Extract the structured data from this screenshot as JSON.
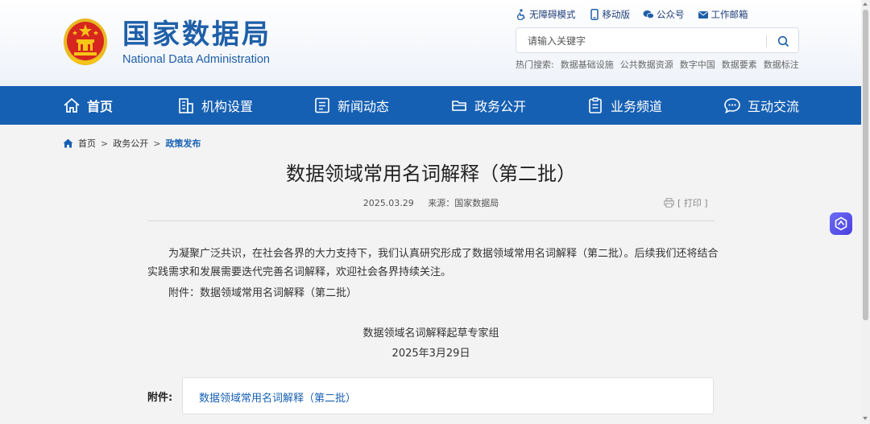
{
  "header": {
    "site_name_cn": "国家数据局",
    "site_name_en": "National Data Administration",
    "top_links": [
      {
        "label": "无障碍模式",
        "icon": "accessibility-icon"
      },
      {
        "label": "移动版",
        "icon": "mobile-icon"
      },
      {
        "label": "公众号",
        "icon": "wechat-icon"
      },
      {
        "label": "工作邮箱",
        "icon": "mail-icon"
      }
    ],
    "search": {
      "placeholder": "请输入关键字",
      "value": ""
    },
    "hot_search": {
      "label": "热门搜索:",
      "items": [
        "数据基础设施",
        "公共数据资源",
        "数字中国",
        "数据要素",
        "数据标注"
      ]
    }
  },
  "nav": {
    "items": [
      {
        "label": "首页",
        "icon": "home-icon"
      },
      {
        "label": "机构设置",
        "icon": "building-icon"
      },
      {
        "label": "新闻动态",
        "icon": "news-icon"
      },
      {
        "label": "政务公开",
        "icon": "folder-icon"
      },
      {
        "label": "业务频道",
        "icon": "clipboard-icon"
      },
      {
        "label": "互动交流",
        "icon": "chat-icon"
      }
    ],
    "active_index": 0
  },
  "breadcrumb": {
    "items": [
      "首页",
      "政务公开",
      "政策发布"
    ],
    "separator": ">"
  },
  "article": {
    "title": "数据领域常用名词解释（第二批）",
    "date": "2025.03.29",
    "source": "来源：国家数据局",
    "print_label": "[ 打印 ]",
    "paragraph1": "为凝聚广泛共识，在社会各界的大力支持下，我们认真研究形成了数据领域常用名词解释（第二批）。后续我们还将结合实践需求和发展需要迭代完善名词解释，欢迎社会各界持续关注。",
    "paragraph2": "附件：数据领域常用名词解释（第二批）",
    "signature": "数据领域名词解释起草专家组",
    "signature_date": "2025年3月29日",
    "attachment_label": "附件:",
    "attachment_link": "数据领域常用名词解释（第二批）"
  },
  "colors": {
    "brand_blue": "#1660b3",
    "logo_blue": "#1f5fa8",
    "emblem_red": "#d7261e",
    "emblem_gold": "#f5c518"
  }
}
